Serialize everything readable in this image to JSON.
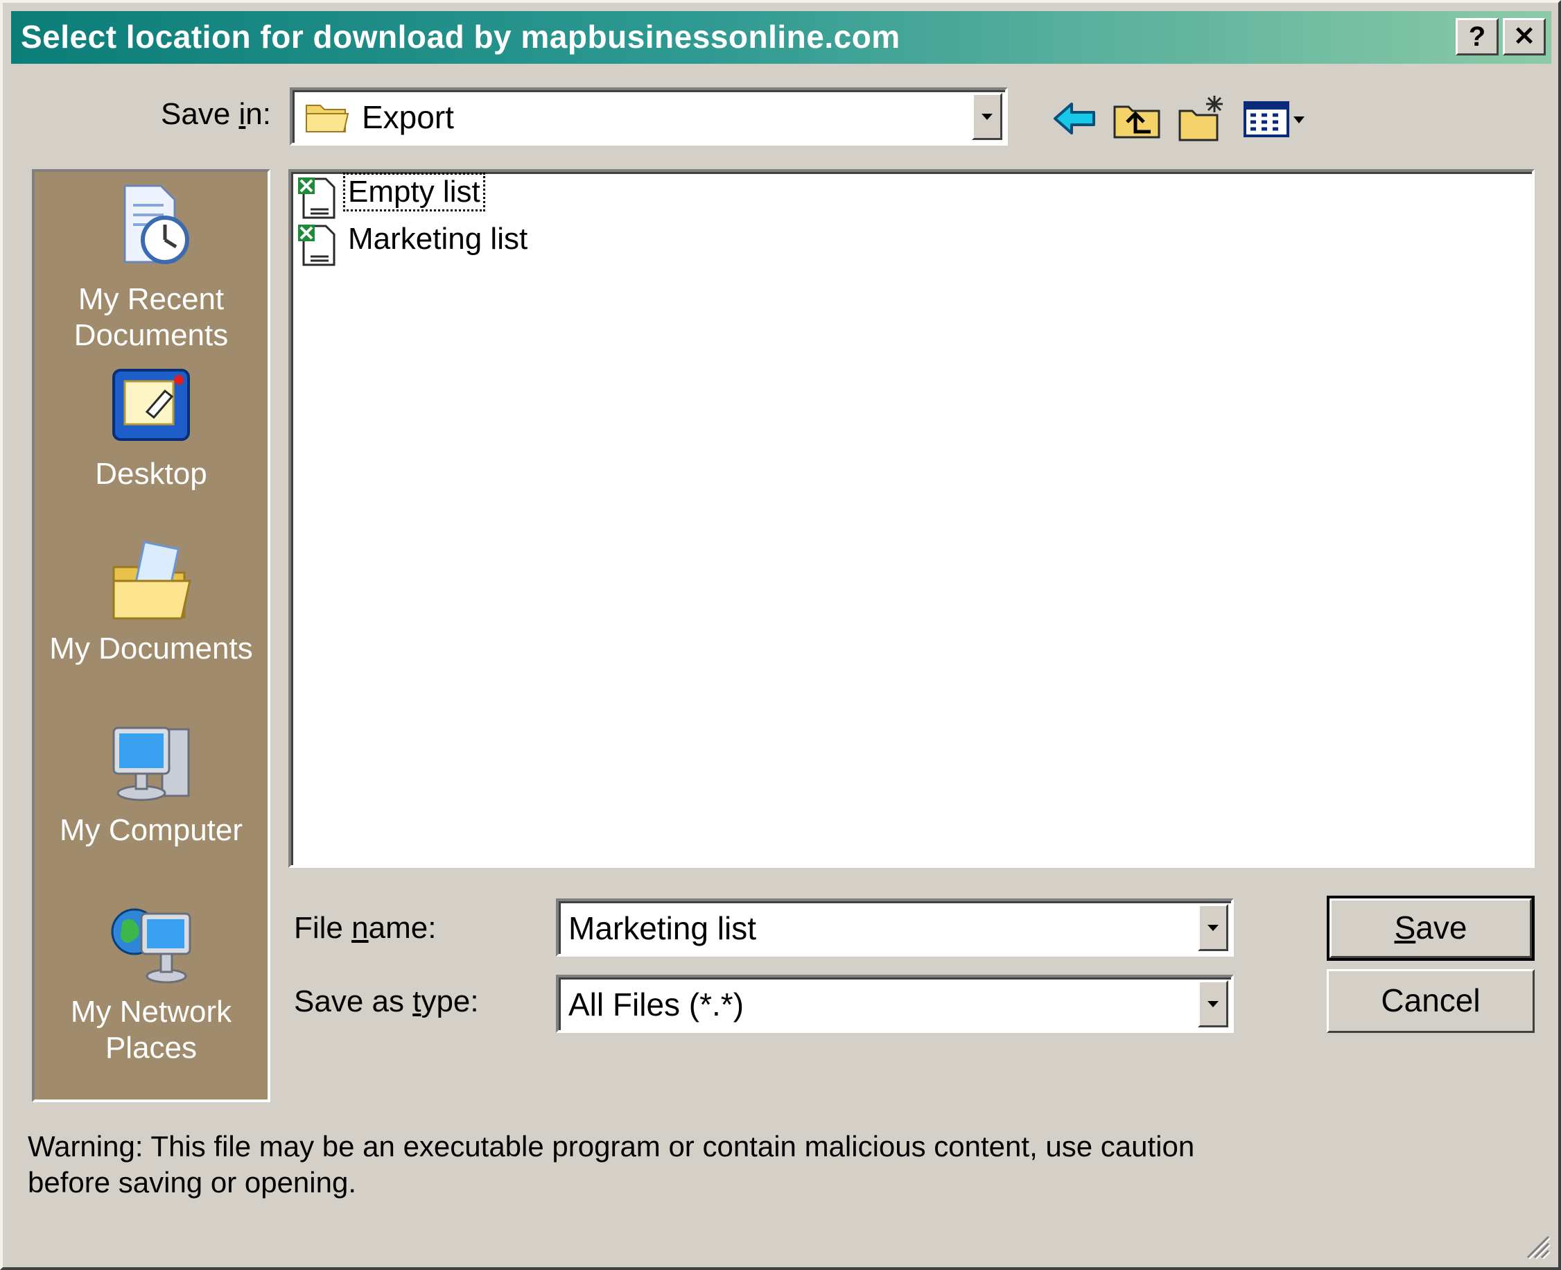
{
  "window": {
    "title": "Select location for download by mapbusinessonline.com",
    "help_button": "?",
    "close_button": "✕"
  },
  "save_in": {
    "label_pre": "Save ",
    "label_key": "i",
    "label_post": "n:",
    "value": "Export",
    "folder_icon": "folder-icon"
  },
  "toolbar": {
    "icons": [
      "back-arrow-icon",
      "up-one-level-icon",
      "new-folder-icon",
      "view-menu-icon"
    ]
  },
  "places": [
    {
      "label_line1": "My Recent",
      "label_line2": "Documents",
      "icon": "recent-documents-icon"
    },
    {
      "label_line1": "Desktop",
      "label_line2": "",
      "icon": "desktop-icon"
    },
    {
      "label_line1": "My Documents",
      "label_line2": "",
      "icon": "my-documents-icon"
    },
    {
      "label_line1": "My Computer",
      "label_line2": "",
      "icon": "my-computer-icon"
    },
    {
      "label_line1": "My Network",
      "label_line2": "Places",
      "icon": "network-places-icon"
    }
  ],
  "files": [
    {
      "name": "Empty list",
      "icon": "excel-file-icon"
    },
    {
      "name": "Marketing list",
      "icon": "excel-file-icon"
    }
  ],
  "file_name": {
    "label_pre": "File ",
    "label_key": "n",
    "label_post": "ame:",
    "value": "Marketing list"
  },
  "save_as_type": {
    "label_pre": "Save as ",
    "label_key": "t",
    "label_post": "ype:",
    "value": "All Files (*.*)"
  },
  "buttons": {
    "save_key": "S",
    "save_rest": "ave",
    "cancel": "Cancel"
  },
  "warning": {
    "line1": "Warning: This file may be an executable program or contain malicious content, use caution",
    "line2": "before saving or opening."
  },
  "colors": {
    "dialog_bg": "#d4d0c8",
    "title_start": "#0c7d78",
    "title_end": "#8ccaa8",
    "places_bg": "#a08c6c"
  }
}
